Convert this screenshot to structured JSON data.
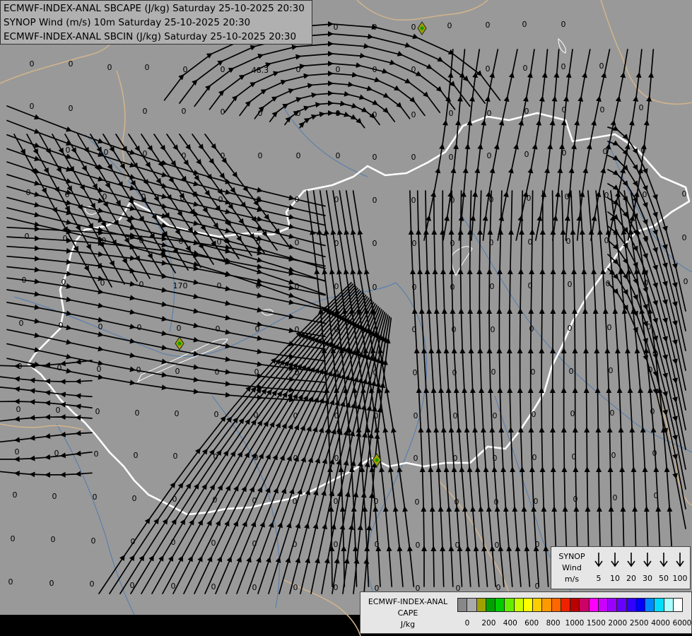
{
  "titles": {
    "line1": "ECMWF-INDEX-ANAL SBCAPE (J/kg) Saturday 25-10-2025 20:30",
    "line2": "SYNOP Wind (m/s) 10m Saturday 25-10-2025 20:30",
    "line3": "ECMWF-INDEX-ANAL SBCIN (J/kg) Saturday 25-10-2025 20:30"
  },
  "map": {
    "background_color": "#999999",
    "border_color": "#ffffff",
    "neighbor_border_color": "#d2b48c",
    "river_color": "#4a78b0",
    "streamline_color": "#000000",
    "special_values": [
      "48.3",
      "170"
    ],
    "grid_value": "0",
    "grid_labels": [
      [
        45,
        90
      ],
      [
        100,
        90
      ],
      [
        155,
        95
      ],
      [
        208,
        95
      ],
      [
        262,
        98
      ],
      [
        315,
        98
      ],
      [
        422,
        98
      ],
      [
        478,
        98
      ],
      [
        530,
        98
      ],
      [
        585,
        98
      ],
      [
        45,
        150
      ],
      [
        100,
        153
      ],
      [
        205,
        157
      ],
      [
        260,
        157
      ],
      [
        315,
        158
      ],
      [
        368,
        160
      ],
      [
        422,
        160
      ],
      [
        478,
        160
      ],
      [
        530,
        162
      ],
      [
        585,
        162
      ],
      [
        638,
        160
      ],
      [
        692,
        160
      ],
      [
        745,
        157
      ],
      [
        798,
        155
      ],
      [
        852,
        155
      ],
      [
        907,
        152
      ],
      [
        96,
        212
      ],
      [
        150,
        215
      ],
      [
        205,
        217
      ],
      [
        260,
        220
      ],
      [
        315,
        220
      ],
      [
        368,
        220
      ],
      [
        422,
        220
      ],
      [
        478,
        220
      ],
      [
        530,
        222
      ],
      [
        585,
        222
      ],
      [
        638,
        222
      ],
      [
        692,
        220
      ],
      [
        745,
        218
      ],
      [
        798,
        216
      ],
      [
        856,
        214
      ],
      [
        910,
        213
      ],
      [
        40,
        272
      ],
      [
        95,
        275
      ],
      [
        148,
        278
      ],
      [
        203,
        278
      ],
      [
        258,
        280
      ],
      [
        312,
        282
      ],
      [
        366,
        282
      ],
      [
        420,
        282
      ],
      [
        476,
        282
      ],
      [
        530,
        283
      ],
      [
        585,
        283
      ],
      [
        640,
        283
      ],
      [
        695,
        282
      ],
      [
        748,
        280
      ],
      [
        802,
        278
      ],
      [
        858,
        276
      ],
      [
        912,
        275
      ],
      [
        968,
        274
      ],
      [
        38,
        334
      ],
      [
        92,
        337
      ],
      [
        147,
        340
      ],
      [
        200,
        340
      ],
      [
        256,
        341
      ],
      [
        310,
        342
      ],
      [
        365,
        342
      ],
      [
        420,
        343
      ],
      [
        476,
        344
      ],
      [
        530,
        344
      ],
      [
        586,
        344
      ],
      [
        640,
        344
      ],
      [
        695,
        343
      ],
      [
        750,
        342
      ],
      [
        804,
        341
      ],
      [
        858,
        340
      ],
      [
        914,
        338
      ],
      [
        968,
        336
      ],
      [
        34,
        396
      ],
      [
        90,
        399
      ],
      [
        145,
        400
      ],
      [
        200,
        402
      ],
      [
        310,
        404
      ],
      [
        365,
        404
      ],
      [
        420,
        405
      ],
      [
        476,
        405
      ],
      [
        530,
        406
      ],
      [
        586,
        406
      ],
      [
        640,
        406
      ],
      [
        696,
        405
      ],
      [
        750,
        404
      ],
      [
        806,
        402
      ],
      [
        860,
        401
      ],
      [
        914,
        400
      ],
      [
        970,
        398
      ],
      [
        30,
        457
      ],
      [
        86,
        460
      ],
      [
        142,
        462
      ],
      [
        197,
        463
      ],
      [
        253,
        464
      ],
      [
        308,
        465
      ],
      [
        364,
        465
      ],
      [
        420,
        466
      ],
      [
        476,
        466
      ],
      [
        531,
        466
      ],
      [
        586,
        466
      ],
      [
        642,
        466
      ],
      [
        697,
        466
      ],
      [
        752,
        465
      ],
      [
        806,
        464
      ],
      [
        862,
        463
      ],
      [
        918,
        462
      ],
      [
        28,
        518
      ],
      [
        84,
        520
      ],
      [
        140,
        522
      ],
      [
        196,
        523
      ],
      [
        251,
        525
      ],
      [
        307,
        526
      ],
      [
        363,
        526
      ],
      [
        420,
        527
      ],
      [
        476,
        527
      ],
      [
        531,
        527
      ],
      [
        587,
        527
      ],
      [
        643,
        527
      ],
      [
        698,
        526
      ],
      [
        754,
        526
      ],
      [
        808,
        525
      ],
      [
        864,
        524
      ],
      [
        920,
        523
      ],
      [
        26,
        579
      ],
      [
        82,
        580
      ],
      [
        138,
        582
      ],
      [
        194,
        584
      ],
      [
        250,
        585
      ],
      [
        306,
        586
      ],
      [
        362,
        587
      ],
      [
        418,
        588
      ],
      [
        476,
        588
      ],
      [
        532,
        588
      ],
      [
        588,
        588
      ],
      [
        644,
        588
      ],
      [
        700,
        588
      ],
      [
        755,
        586
      ],
      [
        810,
        585
      ],
      [
        866,
        584
      ],
      [
        923,
        582
      ],
      [
        24,
        639
      ],
      [
        80,
        641
      ],
      [
        136,
        642
      ],
      [
        192,
        644
      ],
      [
        248,
        645
      ],
      [
        305,
        646
      ],
      [
        362,
        647
      ],
      [
        418,
        648
      ],
      [
        476,
        648
      ],
      [
        532,
        648
      ],
      [
        588,
        648
      ],
      [
        644,
        648
      ],
      [
        700,
        648
      ],
      [
        756,
        647
      ],
      [
        812,
        646
      ],
      [
        868,
        644
      ],
      [
        926,
        641
      ],
      [
        21,
        700
      ],
      [
        77,
        702
      ],
      [
        134,
        703
      ],
      [
        190,
        705
      ],
      [
        247,
        706
      ],
      [
        304,
        707
      ],
      [
        360,
        708
      ],
      [
        417,
        709
      ],
      [
        475,
        709
      ],
      [
        532,
        709
      ],
      [
        590,
        710
      ],
      [
        646,
        710
      ],
      [
        702,
        710
      ],
      [
        758,
        709
      ],
      [
        814,
        706
      ],
      [
        870,
        704
      ],
      [
        928,
        701
      ],
      [
        18,
        762
      ],
      [
        75,
        763
      ],
      [
        132,
        765
      ],
      [
        188,
        766
      ],
      [
        245,
        767
      ],
      [
        302,
        768
      ],
      [
        360,
        769
      ],
      [
        417,
        770
      ],
      [
        475,
        770
      ],
      [
        533,
        770
      ],
      [
        591,
        771
      ],
      [
        647,
        771
      ],
      [
        703,
        771
      ],
      [
        760,
        770
      ],
      [
        15,
        823
      ],
      [
        73,
        825
      ],
      [
        130,
        826
      ],
      [
        187,
        828
      ],
      [
        245,
        829
      ],
      [
        302,
        830
      ],
      [
        360,
        831
      ],
      [
        418,
        831
      ],
      [
        475,
        831
      ],
      [
        533,
        832
      ],
      [
        591,
        832
      ],
      [
        648,
        832
      ],
      [
        705,
        831
      ],
      [
        760,
        829
      ],
      [
        819,
        828
      ],
      [
        877,
        826
      ],
      [
        934,
        823
      ],
      [
        475,
        38
      ],
      [
        530,
        38
      ],
      [
        585,
        38
      ],
      [
        636,
        36
      ],
      [
        690,
        35
      ],
      [
        742,
        34
      ],
      [
        797,
        34
      ],
      [
        851,
        93
      ],
      [
        690,
        97
      ],
      [
        743,
        96
      ],
      [
        797,
        94
      ]
    ],
    "special_positions": [
      [
        368,
        99
      ],
      [
        255,
        404
      ]
    ],
    "cells": [
      [
        597,
        40
      ],
      [
        254,
        486
      ],
      [
        533,
        651
      ]
    ]
  },
  "synop_legend": {
    "title_lines": [
      "SYNOP",
      "Wind",
      "m/s"
    ],
    "speeds": [
      "5",
      "10",
      "20",
      "30",
      "50",
      "100"
    ]
  },
  "cape_legend": {
    "title_lines": [
      "ECMWF-INDEX-ANAL",
      "CAPE",
      "J/kg"
    ],
    "colors": [
      "#888888",
      "#aaaaaa",
      "#a0a000",
      "#00a000",
      "#00cc00",
      "#66ee00",
      "#ccff00",
      "#ffff00",
      "#ffcc00",
      "#ff9900",
      "#ff6600",
      "#ee2200",
      "#bb0000",
      "#cc0066",
      "#ff00ff",
      "#cc00ff",
      "#9900ff",
      "#6600ff",
      "#3300ff",
      "#0000ff",
      "#0088ff",
      "#00ddff",
      "#aaffff",
      "#ffffff"
    ],
    "ticks": [
      "0",
      "200",
      "400",
      "600",
      "800",
      "1000",
      "1500",
      "2000",
      "2500",
      "4000",
      "6000"
    ]
  }
}
